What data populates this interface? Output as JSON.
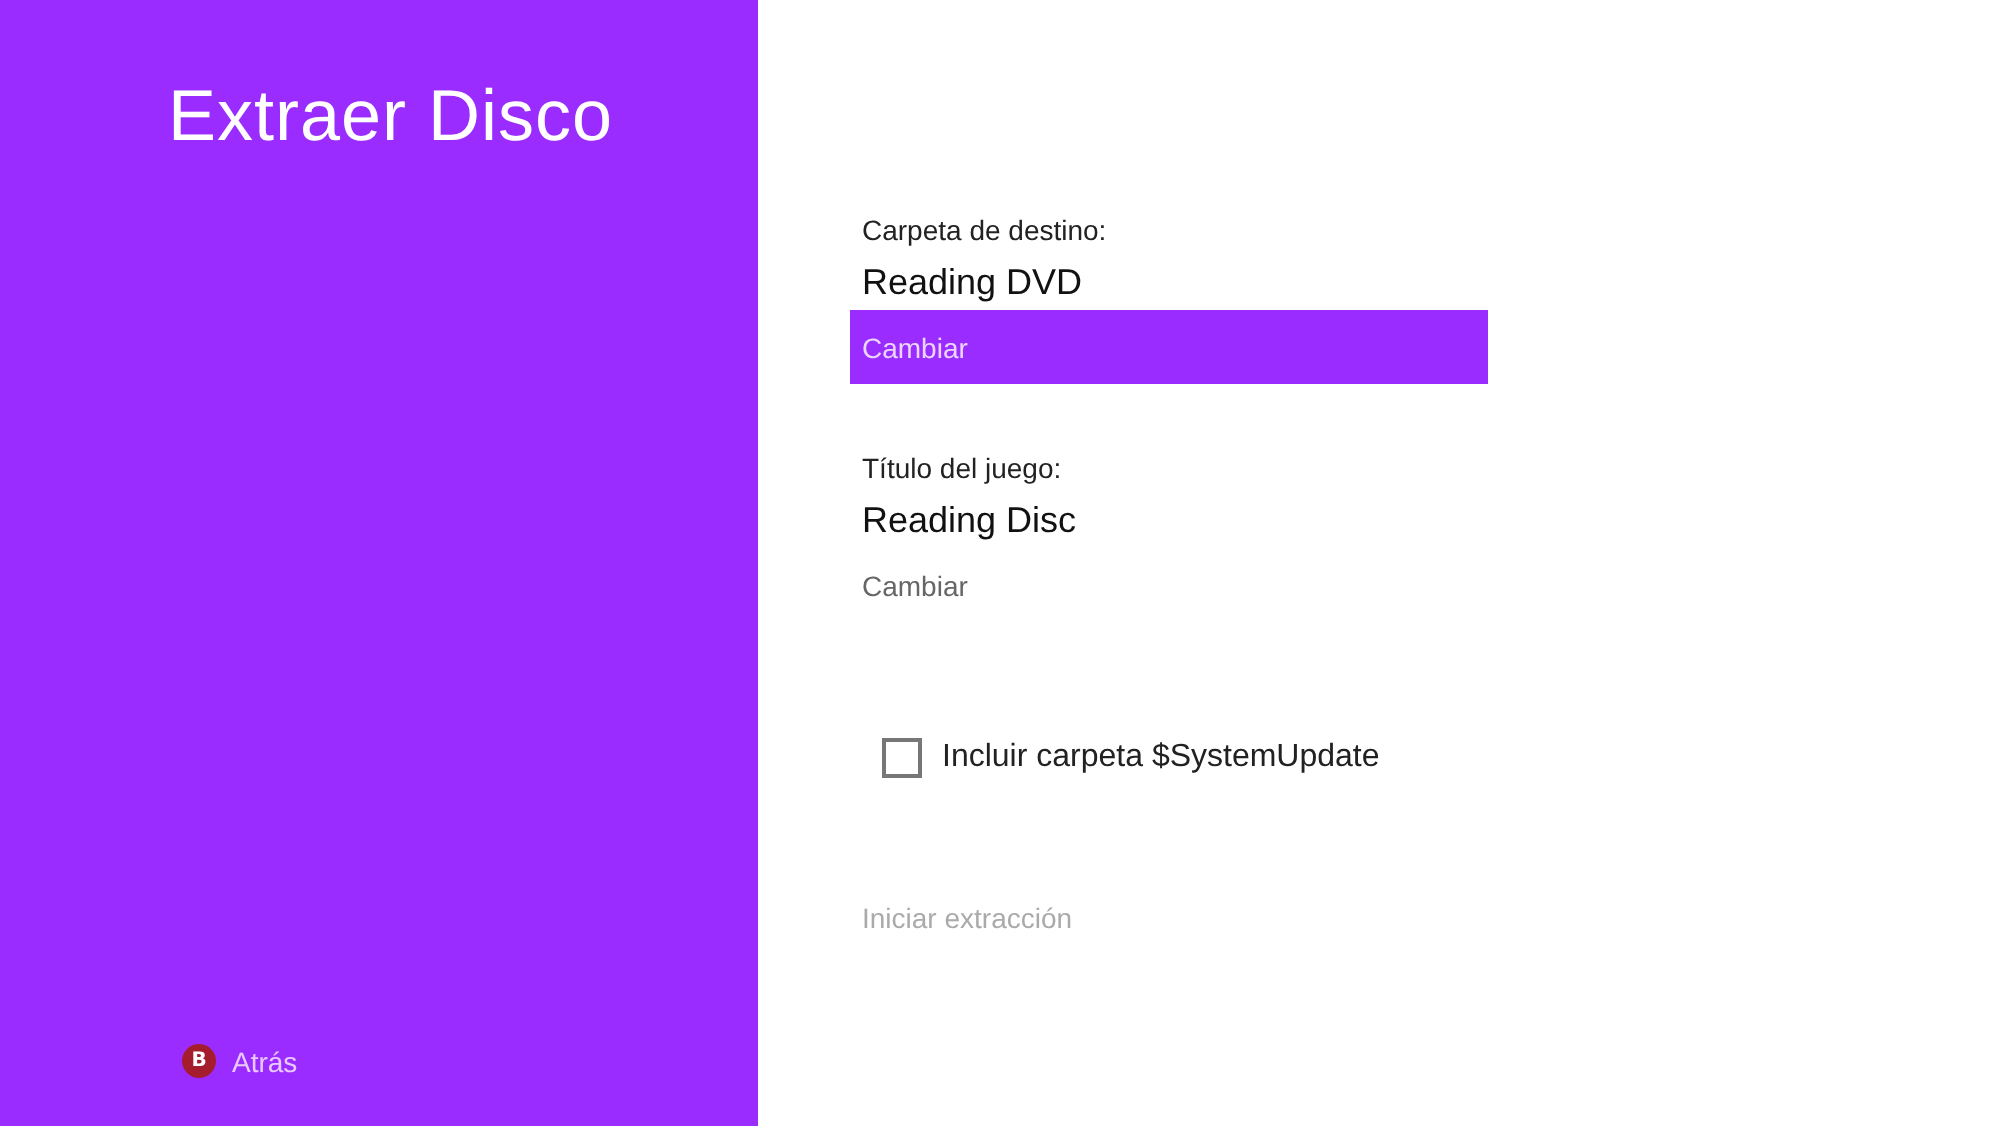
{
  "title": "Extraer Disco",
  "back": {
    "key": "B",
    "label": "Atrás"
  },
  "sections": [
    {
      "label": "Carpeta de destino:",
      "value": "Reading DVD",
      "button": {
        "label": "Cambiar",
        "selected": true
      }
    },
    {
      "label": "Título del juego:",
      "value": "Reading Disc",
      "button": {
        "label": "Cambiar",
        "selected": false
      }
    }
  ],
  "checkbox": {
    "label": "Incluir carpeta $SystemUpdate",
    "checked": false
  },
  "start_button": {
    "label": "Iniciar extracción",
    "disabled": true
  }
}
